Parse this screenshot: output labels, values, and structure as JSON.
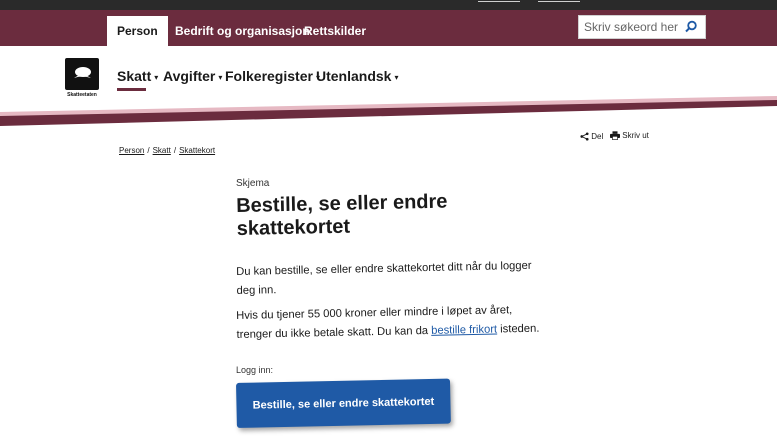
{
  "header": {
    "tabs": [
      {
        "label": "Person",
        "active": true
      },
      {
        "label": "Bedrift og organisasjon",
        "active": false
      },
      {
        "label": "Rettskilder",
        "active": false
      }
    ],
    "search": {
      "placeholder": "Skriv søkeord her",
      "icon": "search-icon"
    }
  },
  "nav": {
    "logo_text": "Skatteetaten",
    "items": [
      {
        "label": "Skatt",
        "active": true
      },
      {
        "label": "Avgifter"
      },
      {
        "label": "Folkeregister"
      },
      {
        "label": "Utenlandsk"
      }
    ],
    "caret": "▾"
  },
  "tools": {
    "share_label": "Del",
    "print_label": "Skriv ut"
  },
  "breadcrumb": {
    "items": [
      "Person",
      "Skatt",
      "Skattekort"
    ],
    "separator": "/"
  },
  "main": {
    "kicker": "Skjema",
    "title": "Bestille, se eller endre skattekortet",
    "paragraph1": "Du kan bestille, se eller endre skattekortet ditt når du logger deg inn.",
    "paragraph2_before": "Hvis du tjener 55 000 kroner eller mindre i løpet av året, trenger du ikke betale skatt. Du kan da ",
    "paragraph2_link": "bestille frikort",
    "paragraph2_after": " isteden.",
    "login_label": "Logg inn:",
    "cta_label": "Bestille, se eller endre skattekortet"
  },
  "colors": {
    "brand": "#6b2c3e",
    "link": "#1f5aa6",
    "button": "#1f5aa6",
    "topbar": "#2a2a2a"
  }
}
